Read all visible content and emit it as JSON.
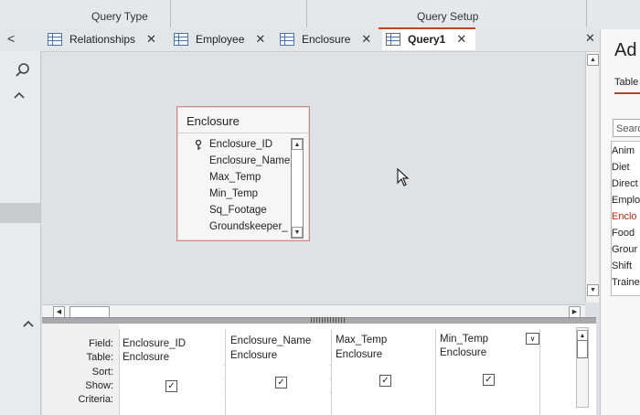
{
  "ribbon": {
    "group_query_type": "Query Type",
    "group_query_setup": "Query Setup"
  },
  "tabs": [
    {
      "label": "Relationships",
      "icon": "relationships-icon",
      "close": "✕"
    },
    {
      "label": "Employee",
      "icon": "table-icon",
      "close": "✕"
    },
    {
      "label": "Enclosure",
      "icon": "table-icon",
      "close": "✕"
    },
    {
      "label": "Query1",
      "icon": "query-icon",
      "close": "✕",
      "active": true
    }
  ],
  "doc_close": "✕",
  "table_box": {
    "title": "Enclosure",
    "fields": [
      "Enclosure_ID",
      "Enclosure_Name",
      "Max_Temp",
      "Min_Temp",
      "Sq_Footage",
      "Groundskeeper_I"
    ]
  },
  "grid": {
    "row_labels": [
      "Field:",
      "Table:",
      "Sort:",
      "Show:",
      "Criteria:"
    ],
    "columns": [
      {
        "field": "Enclosure_ID",
        "table": "Enclosure",
        "show": true
      },
      {
        "field": "Enclosure_Name",
        "table": "Enclosure",
        "show": true
      },
      {
        "field": "Max_Temp",
        "table": "Enclosure",
        "show": true
      },
      {
        "field": "Min_Temp",
        "table": "Enclosure",
        "show": true
      }
    ]
  },
  "right_pane": {
    "title": "Ad",
    "tab": "Table",
    "search": "Searc",
    "items": [
      "Anim",
      "Diet",
      "Direct",
      "Emplo",
      "Enclo",
      "Food",
      "Grour",
      "Shift",
      "Traine"
    ],
    "selected_index": 4
  },
  "colors": {
    "accent": "#b7472a",
    "background": "#dfe2e5"
  }
}
